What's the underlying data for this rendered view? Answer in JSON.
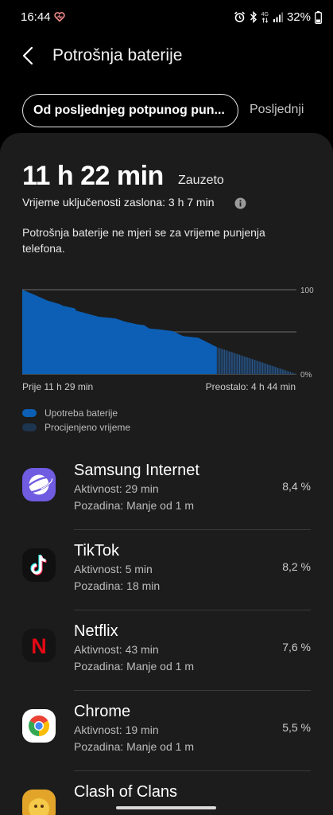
{
  "status_bar": {
    "time": "16:44",
    "network_label": "4G",
    "battery_percent": "32%"
  },
  "header": {
    "title": "Potrošnja baterije"
  },
  "tabs": {
    "active_label": "Od posljednjeg potpunog pun...",
    "other_label": "Posljednji"
  },
  "summary": {
    "total_time": "11 h 22 min",
    "status": "Zauzeto",
    "screen_on": "Vrijeme uključenosti zaslona: 3 h 7 min",
    "note": "Potrošnja baterije ne mjeri se za vrijeme punjenja telefona."
  },
  "chart_data": {
    "type": "area",
    "ylim": [
      0,
      100
    ],
    "y_ticks": [
      "100",
      "0%"
    ],
    "x_start_label": "Prije 11 h 29 min",
    "x_end_label": "Preostalo: 4 h 44 min",
    "x_hours_since_full": [
      0,
      0.6,
      1.5,
      2.2,
      2.4,
      3.1,
      3.2,
      3.6,
      4.5,
      5.5,
      6.1,
      6.8,
      7.2,
      7.5,
      8.1,
      8.9,
      9.5,
      10.4,
      11.5
    ],
    "y_battery": [
      100,
      95,
      87,
      83,
      81,
      78,
      75,
      73,
      68,
      66,
      62,
      59,
      58,
      54,
      53,
      51,
      45,
      43,
      32
    ],
    "estimated": {
      "from_hour": 11.5,
      "to_hour": 16.2,
      "y_start": 32,
      "y_end": 0
    },
    "series": [
      {
        "name": "Upotreba baterije",
        "color": "#0c5fb4"
      },
      {
        "name": "Procijenjeno vrijeme",
        "color": "#1e3550"
      }
    ],
    "grid": true
  },
  "legend": {
    "usage_label": "Upotreba baterije",
    "estimated_label": "Procijenjeno vrijeme"
  },
  "apps": [
    {
      "name": "Samsung Internet",
      "active": "Aktivnost: 29 min",
      "background": "Pozadina: Manje od 1 m",
      "percent": "8,4 %",
      "icon": "samsung-internet-icon"
    },
    {
      "name": "TikTok",
      "active": "Aktivnost: 5 min",
      "background": "Pozadina: 18 min",
      "percent": "8,2 %",
      "icon": "tiktok-icon"
    },
    {
      "name": "Netflix",
      "active": "Aktivnost: 43 min",
      "background": "Pozadina: Manje od 1 m",
      "percent": "7,6 %",
      "icon": "netflix-icon",
      "icon_letter": "N"
    },
    {
      "name": "Chrome",
      "active": "Aktivnost: 19 min",
      "background": "Pozadina: Manje od 1 m",
      "percent": "5,5 %",
      "icon": "chrome-icon"
    },
    {
      "name": "Clash of Clans",
      "active": "",
      "background": "",
      "percent": "",
      "icon": "clash-of-clans-icon"
    }
  ]
}
